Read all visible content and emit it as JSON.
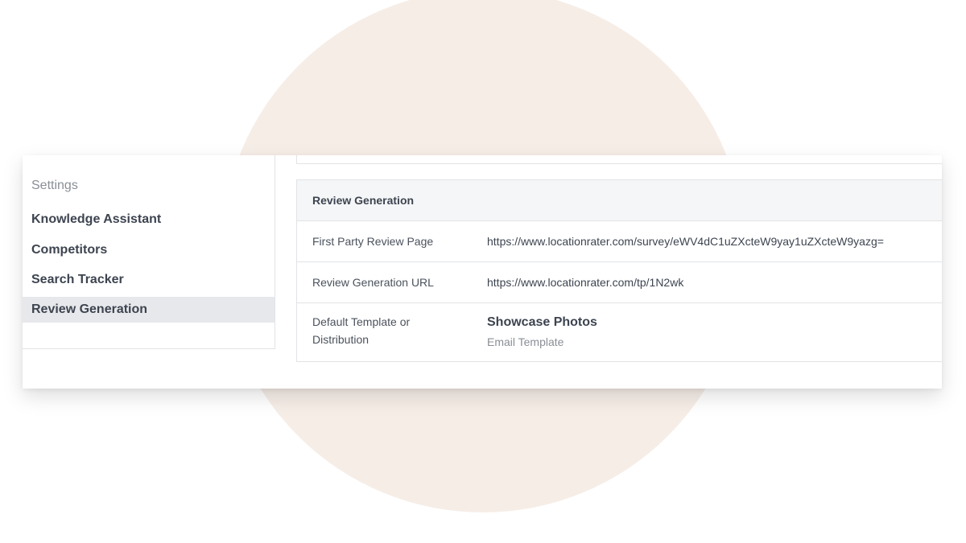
{
  "sidebar": {
    "heading": "Settings",
    "items": [
      {
        "label": "Knowledge Assistant",
        "active": false
      },
      {
        "label": "Competitors",
        "active": false
      },
      {
        "label": "Search Tracker",
        "active": false
      },
      {
        "label": "Review Generation",
        "active": true
      }
    ]
  },
  "panel": {
    "title": "Review Generation",
    "rows": [
      {
        "label": "First Party Review Page",
        "value": "https://www.locationrater.com/survey/eWV4dC1uZXcteW9yay1uZXcteW9yazg="
      },
      {
        "label": "Review Generation URL",
        "value": "https://www.locationrater.com/tp/1N2wk"
      },
      {
        "label_line1": "Default Template or",
        "label_line2": "Distribution",
        "value_title": "Showcase Photos",
        "value_sub": "Email Template"
      }
    ]
  },
  "colors": {
    "background_circle": "#f6ede7",
    "active_item_bg": "#e7e8eb",
    "header_bg": "#f5f6f7",
    "text_primary": "#3d4450",
    "text_muted": "#8a8f96"
  }
}
